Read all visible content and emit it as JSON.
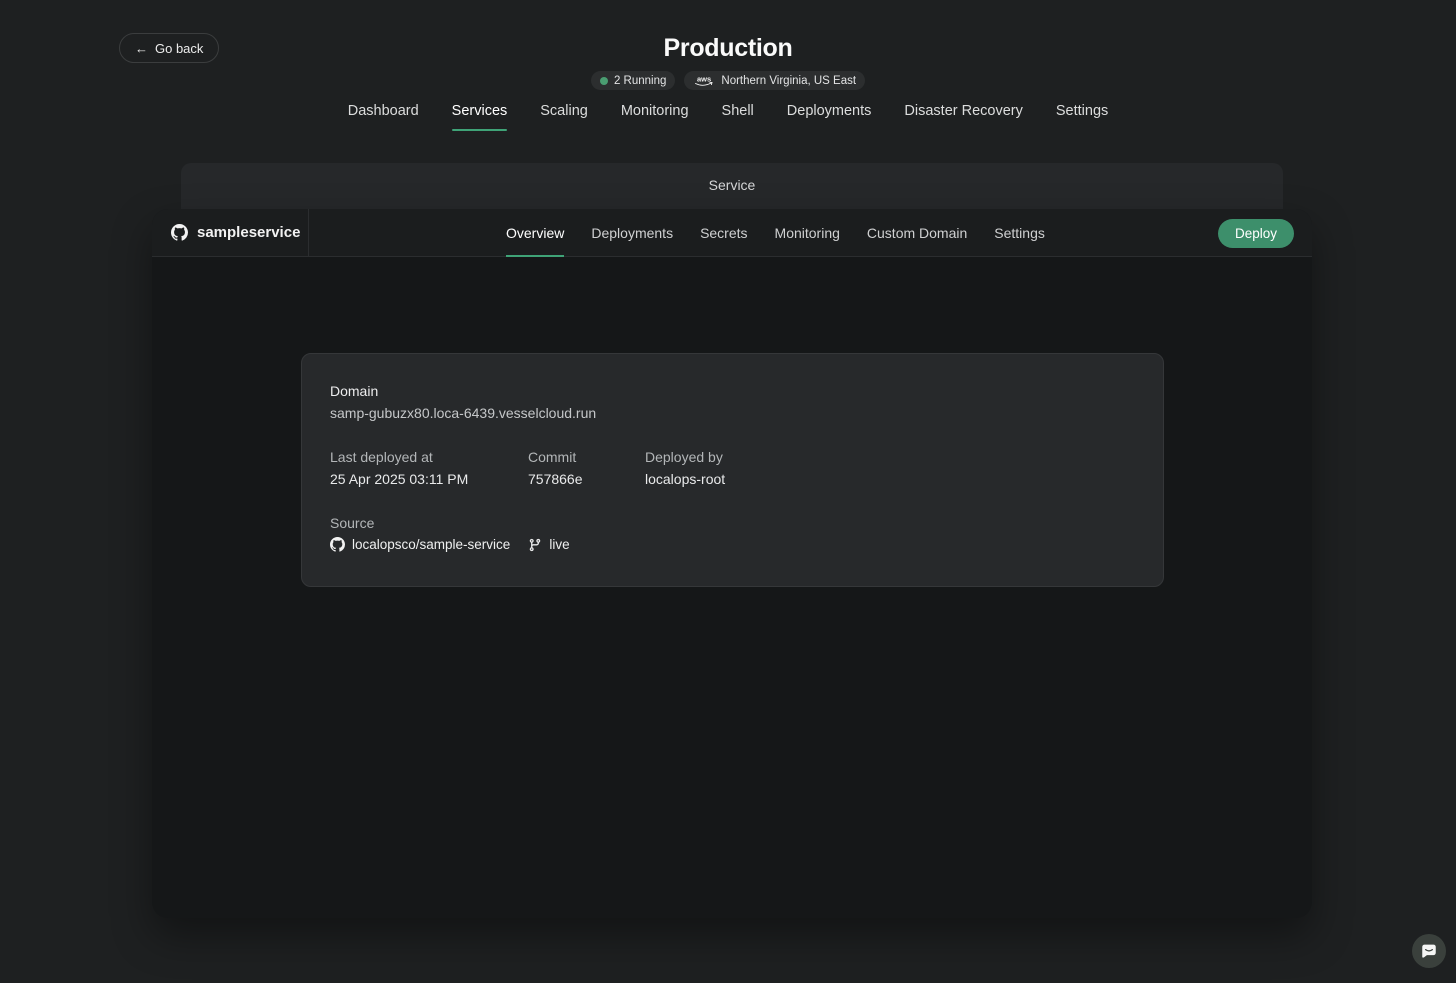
{
  "header": {
    "back_arrow": "←",
    "go_back_label": "Go back",
    "title": "Production",
    "running_badge": "2 Running",
    "region_badge": "Northern Virginia, US East"
  },
  "nav": {
    "items": [
      "Dashboard",
      "Services",
      "Scaling",
      "Monitoring",
      "Shell",
      "Deployments",
      "Disaster Recovery",
      "Settings"
    ],
    "active": "Services"
  },
  "service_bar": {
    "title": "Service"
  },
  "service_panel": {
    "name": "sampleservice",
    "tabs": [
      "Overview",
      "Deployments",
      "Secrets",
      "Monitoring",
      "Custom Domain",
      "Settings"
    ],
    "active_tab": "Overview",
    "deploy_label": "Deploy"
  },
  "card": {
    "domain_label": "Domain",
    "domain_value": "samp-gubuzx80.loca-6439.vesselcloud.run",
    "deploy_info": [
      {
        "label": "Last deployed at",
        "value": "25 Apr 2025 03:11 PM"
      },
      {
        "label": "Commit",
        "value": "757866e"
      },
      {
        "label": "Deployed by",
        "value": "localops-root"
      }
    ],
    "source_label": "Source",
    "source_repo": "localopsco/sample-service",
    "source_branch": "live"
  },
  "icons": {
    "github": "github-icon",
    "git_branch": "git-branch-icon",
    "aws": "aws-logo-icon",
    "chat": "chat-bubble-icon",
    "status_dot": "status-dot-icon"
  },
  "colors": {
    "accent_green": "#3fa377",
    "deploy_green": "#3d8f6b",
    "status_green": "#4a9d71"
  }
}
